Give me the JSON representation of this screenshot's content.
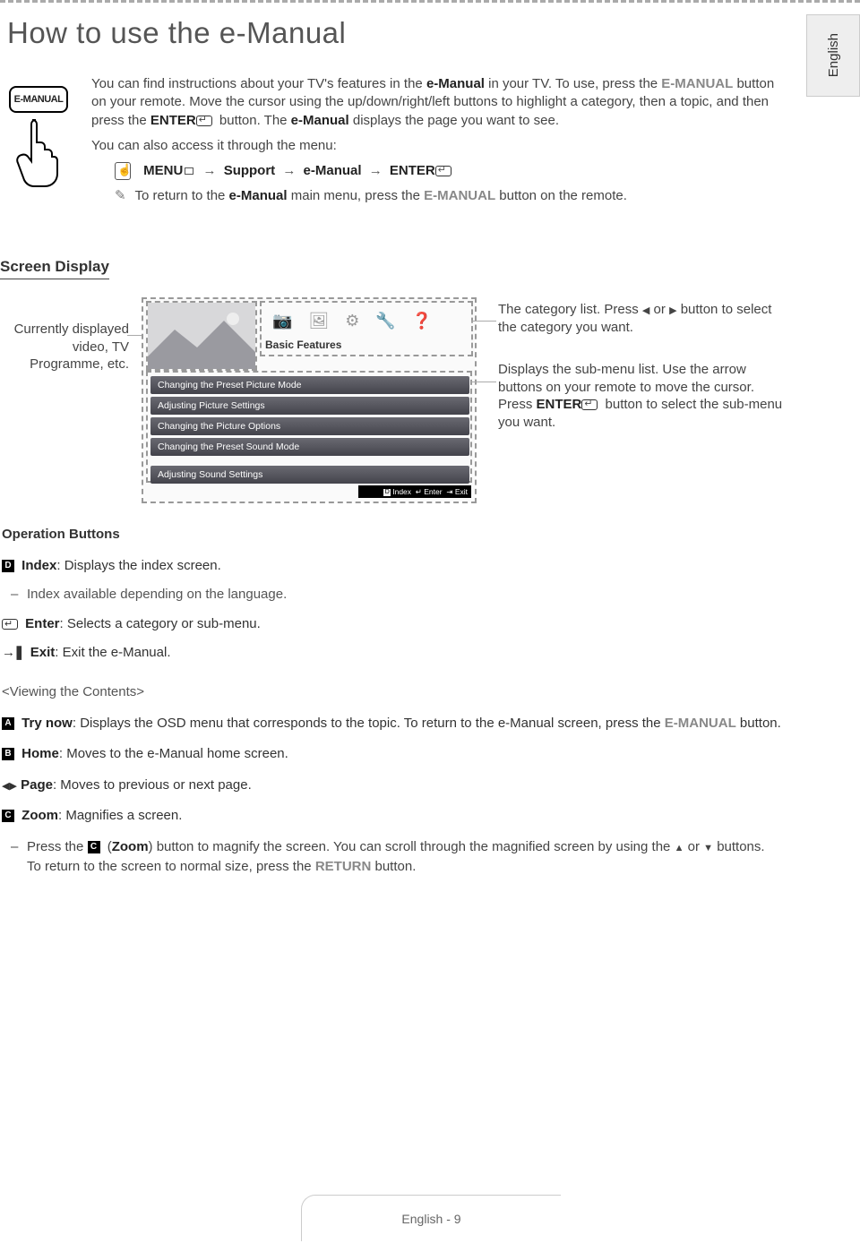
{
  "language_tab": "English",
  "title": "How to use the e-Manual",
  "remote_button_label": "E-MANUAL",
  "intro": {
    "p1a": "You can find instructions about your TV's features in the ",
    "p1b": "e-Manual",
    "p1c": " in your TV. To use, press the ",
    "p1d": "E-MANUAL",
    "p1e": " button on your remote. Move the cursor using the up/down/right/left buttons to highlight a category, then a topic, and then press the ",
    "p1f": "ENTER",
    "p1g": " button. The ",
    "p1h": "e-Manual",
    "p1i": " displays the page you want to see.",
    "p2": "You can also access it through the menu:",
    "menu_path_a": "MENU",
    "menu_path_b": "Support",
    "menu_path_c": "e-Manual",
    "menu_path_d": "ENTER",
    "note_a": "To return to the ",
    "note_b": "e-Manual",
    "note_c": " main menu, press the ",
    "note_d": "E-MANUAL",
    "note_e": " button on the remote."
  },
  "section_screen_display": "Screen Display",
  "callout_left": "Currently displayed video, TV Programme, etc.",
  "screen": {
    "category_title": "Basic Features",
    "submenu": [
      "Changing the Preset Picture Mode",
      "Adjusting Picture Settings",
      "Changing the Picture Options",
      "Changing the Preset Sound Mode",
      "Adjusting Sound Settings"
    ],
    "footer_index": "Index",
    "footer_enter": "Enter",
    "footer_exit": "Exit"
  },
  "callout_r1a": "The category list. Press ",
  "callout_r1b": " or ",
  "callout_r1c": " button to select the category you want.",
  "callout_r2a": "Displays the sub-menu list. Use the arrow buttons on your remote to move the cursor. Press ",
  "callout_r2b": "ENTER",
  "callout_r2c": " button to select the sub-menu you want.",
  "ops": {
    "heading": "Operation Buttons",
    "index_label": "Index",
    "index_desc": ": Displays the index screen.",
    "index_sub": "Index available depending on the language.",
    "enter_label": "Enter",
    "enter_desc": ": Selects a category or sub-menu.",
    "exit_label": "Exit",
    "exit_desc": ": Exit the e-Manual."
  },
  "vc": {
    "heading": "<Viewing the Contents>",
    "try_label": "Try now",
    "try_desc_a": ": Displays the OSD menu that corresponds to the topic. To return to the e-Manual screen, press the ",
    "try_desc_b": "E-MANUAL",
    "try_desc_c": " button.",
    "home_label": "Home",
    "home_desc": ": Moves to the e-Manual home screen.",
    "page_label": "Page",
    "page_desc": ": Moves to previous or next page.",
    "zoom_label": "Zoom",
    "zoom_desc": ": Magnifies a screen.",
    "zoom_sub_a": "Press the ",
    "zoom_sub_b": "Zoom",
    "zoom_sub_c": ") button to magnify the screen. You can scroll through the magnified screen by using the ",
    "zoom_sub_d": " or ",
    "zoom_sub_e": " buttons. To return to the screen to normal size, press the ",
    "zoom_sub_f": "RETURN",
    "zoom_sub_g": " button."
  },
  "page_footer": "English - 9",
  "letters": {
    "A": "A",
    "B": "B",
    "C": "C",
    "D": "D"
  }
}
